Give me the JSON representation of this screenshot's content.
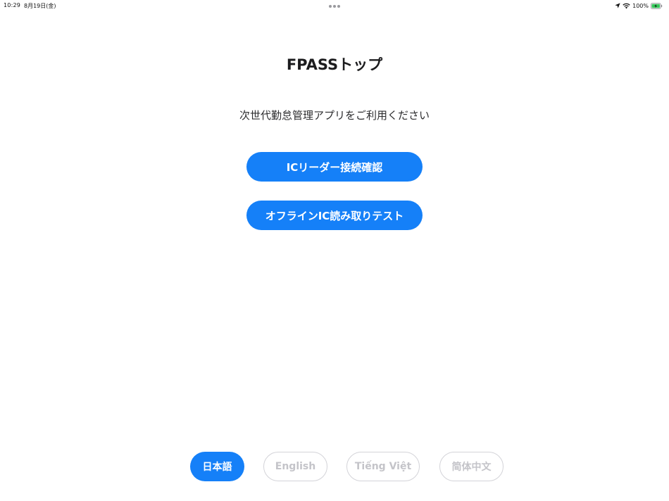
{
  "status_bar": {
    "time": "10:29",
    "date": "8月19日(金)",
    "battery": "100%",
    "icons": [
      "location-icon",
      "wifi-icon",
      "battery-charging-icon"
    ]
  },
  "page": {
    "title": "FPASSトップ",
    "subtitle": "次世代勤怠管理アプリをご利用ください"
  },
  "buttons": {
    "reader_check": "ICリーダー接続確認",
    "offline_test": "オフラインIC読み取りテスト"
  },
  "languages": [
    {
      "label": "日本語",
      "selected": true
    },
    {
      "label": "English",
      "selected": false
    },
    {
      "label": "Tiếng Việt",
      "selected": false
    },
    {
      "label": "简体中文",
      "selected": false
    }
  ],
  "colors": {
    "accent": "#1580f8",
    "inactive_text": "#c4c4c9",
    "inactive_border": "#d3d3d8",
    "battery_green": "#34c759"
  }
}
